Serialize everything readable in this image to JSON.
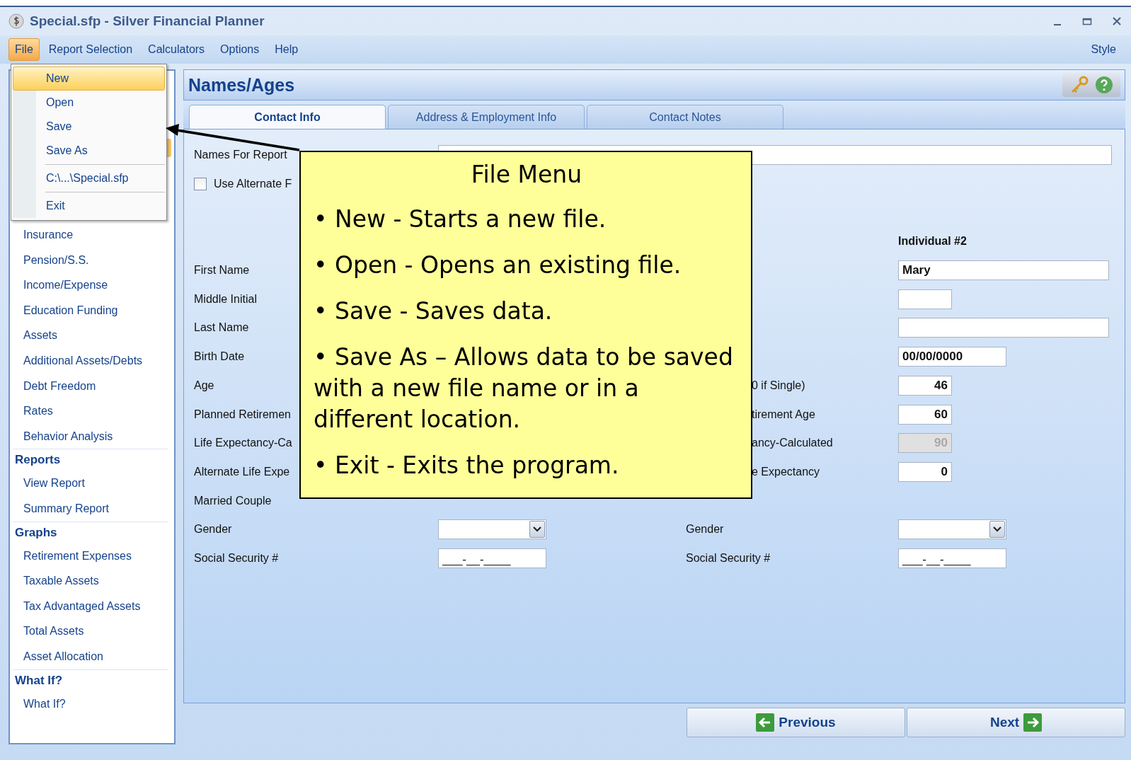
{
  "window": {
    "title": "Special.sfp - Silver Financial Planner"
  },
  "menu_bar": {
    "items": [
      {
        "label": "File",
        "selected": true
      },
      {
        "label": "Report Selection",
        "selected": false
      },
      {
        "label": "Calculators",
        "selected": false
      },
      {
        "label": "Options",
        "selected": false
      },
      {
        "label": "Help",
        "selected": false
      }
    ],
    "right_item": "Style"
  },
  "file_menu": {
    "items": [
      {
        "kind": "item",
        "label": "New",
        "selected": true
      },
      {
        "kind": "item",
        "label": "Open",
        "selected": false
      },
      {
        "kind": "item",
        "label": "Save",
        "selected": false
      },
      {
        "kind": "item",
        "label": "Save As",
        "selected": false
      },
      {
        "kind": "separator"
      },
      {
        "kind": "item",
        "label": "C:\\...\\Special.sfp",
        "selected": false
      },
      {
        "kind": "separator"
      },
      {
        "kind": "item",
        "label": "Exit",
        "selected": false
      }
    ]
  },
  "sidebar": {
    "sections": [
      {
        "items": [
          "Insurance",
          "Pension/S.S.",
          "Income/Expense",
          "Education Funding",
          "Assets",
          "Additional Assets/Debts",
          "Debt Freedom",
          "Rates",
          "Behavior Analysis"
        ]
      },
      {
        "title": "Reports",
        "items": [
          "View Report",
          "Summary Report"
        ]
      },
      {
        "title": "Graphs",
        "items": [
          "Retirement Expenses",
          "Taxable Assets",
          "Tax Advantaged Assets",
          "Total Assets",
          "Asset Allocation"
        ]
      },
      {
        "title": "What If?",
        "items": [
          "What If?"
        ]
      }
    ]
  },
  "page": {
    "title": "Names/Ages",
    "tabs": [
      {
        "label": "Contact Info",
        "selected": true
      },
      {
        "label": "Address & Employment Info",
        "selected": false
      },
      {
        "label": "Contact Notes",
        "selected": false
      }
    ],
    "names_for_report_label": "Names For Report",
    "alternate_checkbox": {
      "label": "Use Alternate F",
      "checked": false
    },
    "individual_2_heading": "Individual #2",
    "rows": [
      {
        "kind": "covered",
        "left_label": "First Name",
        "right_field": {
          "kind": "text",
          "value": "Mary"
        }
      },
      {
        "kind": "covered",
        "left_label": "Middle Initial",
        "right_field": {
          "kind": "short_text"
        }
      },
      {
        "kind": "covered",
        "left_label": "Last Name",
        "right_field": {
          "kind": "text"
        }
      },
      {
        "kind": "covered",
        "left_label": "Birth Date",
        "right_field": {
          "kind": "date",
          "value": "00/00/0000"
        }
      },
      {
        "kind": "covered",
        "left_label": "Age",
        "right_label": "0 if Single)",
        "right_field": {
          "kind": "number",
          "value": "46",
          "disabled": false
        }
      },
      {
        "kind": "covered",
        "left_label": "Planned Retiremen",
        "right_label": "tirement Age",
        "right_field": {
          "kind": "number",
          "value": "60",
          "disabled": false
        }
      },
      {
        "kind": "covered",
        "left_label": "Life Expectancy-Ca",
        "right_label": "ancy-Calculated",
        "right_field": {
          "kind": "number",
          "value": "90",
          "disabled": true
        }
      },
      {
        "kind": "covered",
        "left_label": "Alternate Life Expe",
        "right_label": "e Expectancy",
        "right_field": {
          "kind": "number",
          "value": "0",
          "disabled": false
        }
      },
      {
        "kind": "covered",
        "left_label": "Married Couple"
      },
      {
        "kind": "full",
        "left_label": "Gender",
        "left_field": {
          "kind": "dropdown"
        },
        "right_label": "Gender",
        "right_field": {
          "kind": "dropdown"
        }
      },
      {
        "kind": "full",
        "left_label": "Social Security #",
        "left_field": {
          "kind": "ssn",
          "value": "___-__-____"
        },
        "right_label": "Social Security #",
        "right_field": {
          "kind": "ssn",
          "value": "___-__-____"
        }
      }
    ]
  },
  "buttons": {
    "previous": "Previous",
    "next": "Next"
  },
  "callout": {
    "title": "File Menu",
    "bullets": [
      "• New - Starts a new file.",
      "• Open - Opens an existing file.",
      "• Save - Saves data.",
      "• Save As – Allows data to be saved with a new file name or in a different location.",
      "• Exit - Exits the program."
    ]
  }
}
